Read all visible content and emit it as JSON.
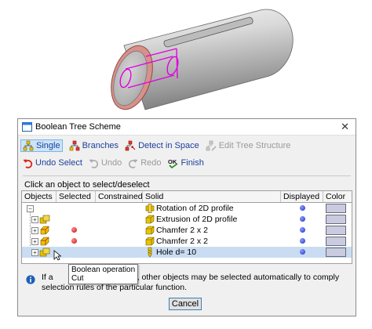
{
  "dialog": {
    "title": "Boolean Tree Scheme",
    "close_icon": "close-icon"
  },
  "toolbar": {
    "single": "Single",
    "branches": "Branches",
    "detect": "Detect in Space",
    "edit_tree": "Edit Tree Structure",
    "undo_select": "Undo Select",
    "undo": "Undo",
    "redo": "Redo",
    "finish": "Finish"
  },
  "instruction": "Click an object to select/deselect",
  "table": {
    "columns": [
      "Objects",
      "Selected",
      "Constrained",
      "Solid",
      "Displayed",
      "Color"
    ],
    "rows": [
      {
        "solid": "Rotation of 2D profile",
        "selected": false,
        "displayed": true,
        "depth": 0
      },
      {
        "solid": "Extrusion of 2D profile",
        "selected": false,
        "displayed": true,
        "depth": 1
      },
      {
        "solid": "Chamfer 2 x 2",
        "selected": true,
        "displayed": true,
        "depth": 1
      },
      {
        "solid": "Chamfer 2 x 2",
        "selected": true,
        "displayed": true,
        "depth": 1
      },
      {
        "solid": "Hole d= 10",
        "selected": false,
        "displayed": true,
        "depth": 1
      }
    ]
  },
  "tooltip": {
    "line1": "Boolean operation",
    "line2": "Cut"
  },
  "info": {
    "text_before": "If a",
    "text_after": "selected, other objects may be selected automatically to comply selection rules of the particular function."
  },
  "buttons": {
    "cancel": "Cancel"
  },
  "colors": {
    "accent": "#1a3f9b",
    "selected_row": "#c9dcf2",
    "body_swatch": "#c9cbe0"
  }
}
